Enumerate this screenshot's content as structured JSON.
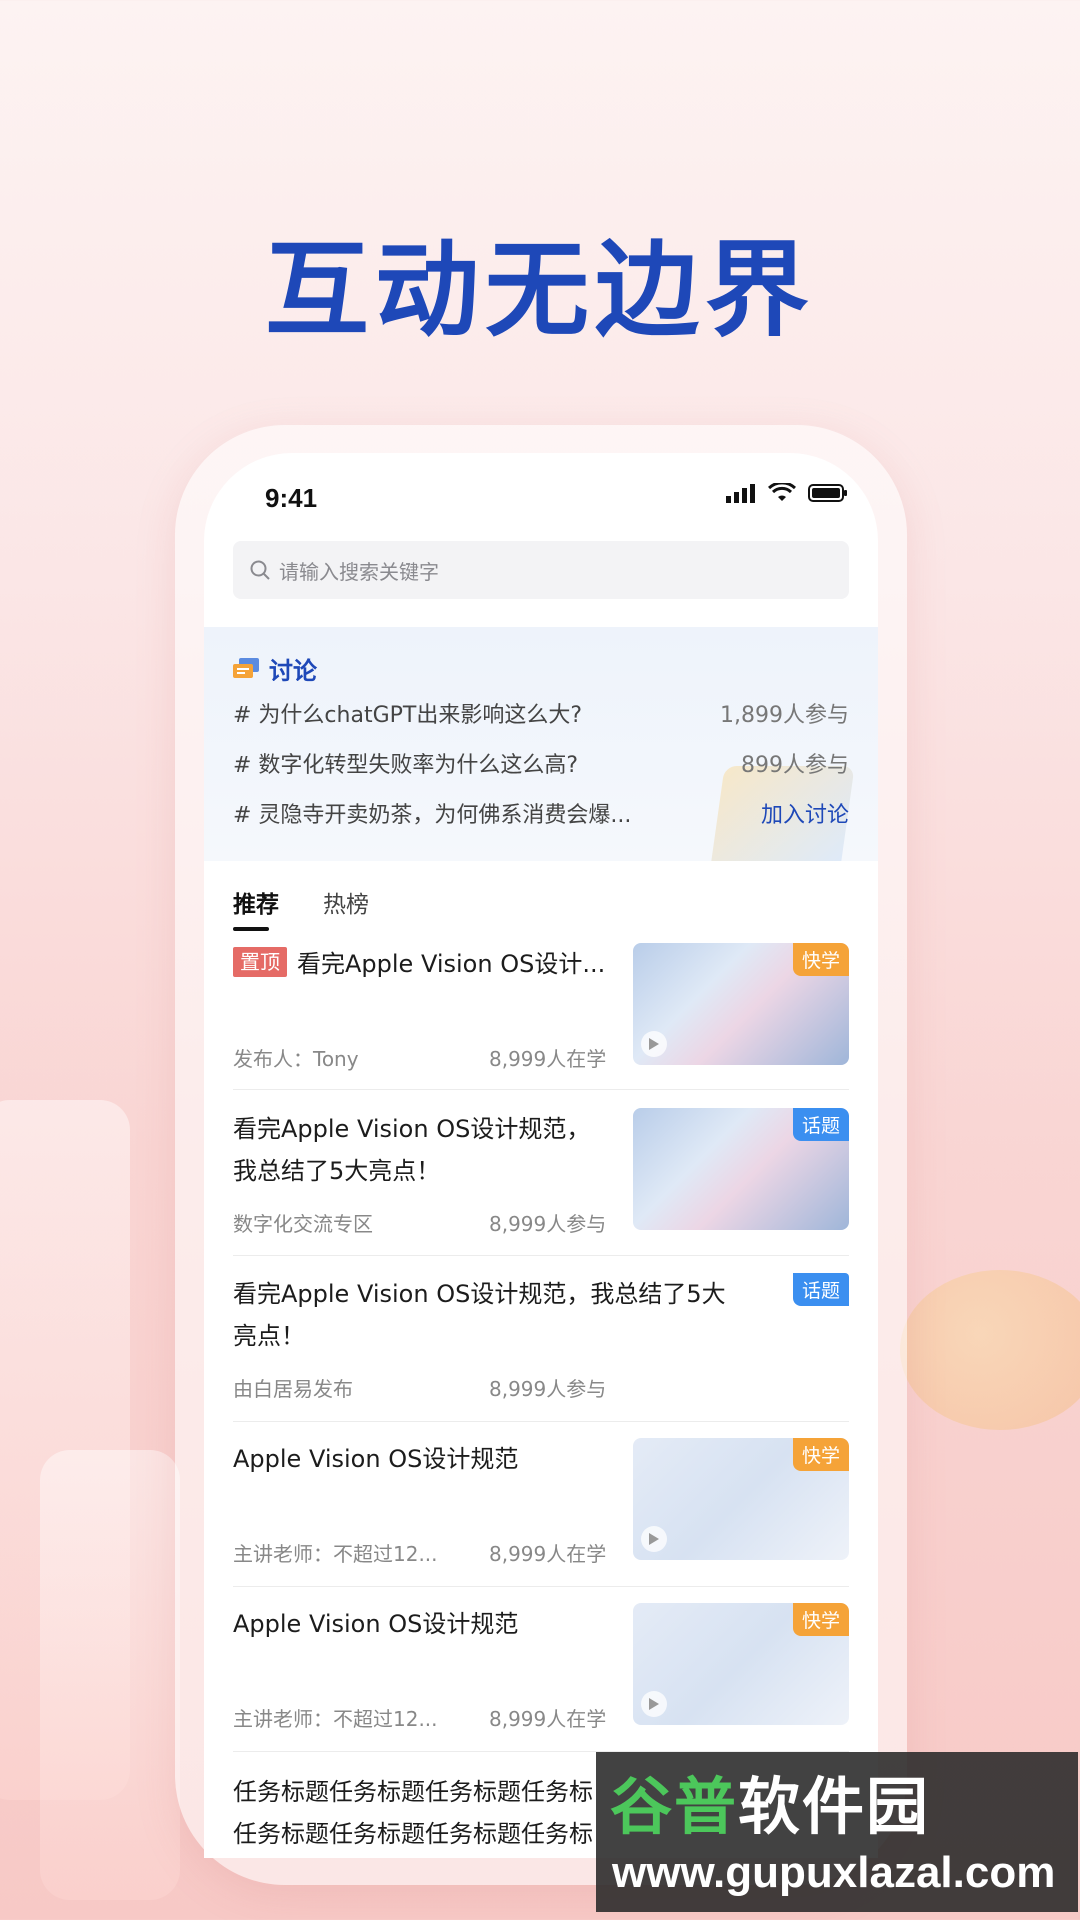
{
  "headline": "互动无边界",
  "status_bar": {
    "time": "9:41"
  },
  "search": {
    "placeholder": "请输入搜索关键字"
  },
  "discussion": {
    "title": "讨论",
    "topics": [
      {
        "text": "# 为什么chatGPT出来影响这么大?",
        "count": "1,899人参与"
      },
      {
        "text": "# 数字化转型失败率为什么这么高?",
        "count": "899人参与"
      },
      {
        "text": "# 灵隐寺开卖奶茶，为何佛系消费会爆...",
        "action": "加入讨论"
      }
    ]
  },
  "tabs": [
    {
      "label": "推荐",
      "active": true
    },
    {
      "label": "热榜",
      "active": false
    }
  ],
  "feed": [
    {
      "tag": "置顶",
      "title": "看完Apple Vision OS设计...",
      "meta_left": "发布人：Tony",
      "meta_right": "8,999人在学",
      "badge": "快学",
      "badge_color": "#f5a338",
      "thumb": "keyboard"
    },
    {
      "title_line1": "看完Apple Vision OS设计规范，",
      "title_line2": "我总结了5大亮点！",
      "meta_left": "数字化交流专区",
      "meta_right": "8,999人参与",
      "badge": "话题",
      "badge_color": "#3b8ff0",
      "thumb": "keyboard"
    },
    {
      "title_line1": "看完Apple Vision OS设计规范，我总结了5大",
      "title_line2": "亮点！",
      "meta_left": "由白居易发布",
      "meta_right": "8,999人参与",
      "badge": "话题",
      "badge_color": "#3b8ff0"
    },
    {
      "title": "Apple Vision OS设计规范",
      "meta_left": "主讲老师：不超过12...",
      "meta_right": "8,999人在学",
      "badge": "快学",
      "badge_color": "#f5a338",
      "thumb": "drone"
    },
    {
      "title": "Apple Vision OS设计规范",
      "meta_left": "主讲老师：不超过12...",
      "meta_right": "8,999人在学",
      "badge": "快学",
      "badge_color": "#f5a338",
      "thumb": "drone"
    },
    {
      "title_line1": "任务标题任务标题任务标题任务标",
      "title_line2": "任务标题任务标题任务标题任务标"
    }
  ],
  "watermark": {
    "brand_green": "谷普",
    "brand_white": "软件园",
    "url": "www.gupuxlazal.com"
  }
}
